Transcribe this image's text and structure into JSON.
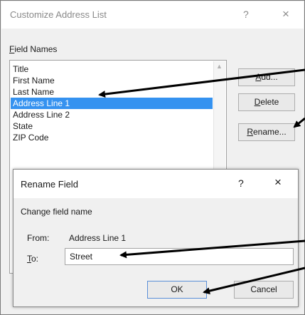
{
  "main_dialog": {
    "title": "Customize Address List",
    "help_glyph": "?",
    "close_glyph": "×",
    "field_names_label_accel": "F",
    "field_names_label_rest": "ield Names",
    "fields": [
      "Title",
      "First Name",
      "Last Name",
      "Address Line 1",
      "Address Line 2",
      "State",
      "ZIP Code"
    ],
    "selected_index": 3,
    "buttons": {
      "add_accel": "A",
      "add_rest": "dd...",
      "delete_pre": "",
      "delete_accel": "D",
      "delete_rest": "elete",
      "rename_accel": "R",
      "rename_rest": "ename..."
    }
  },
  "rename_dialog": {
    "title": "Rename Field",
    "help_glyph": "?",
    "close_glyph": "×",
    "change_label": "Change field name",
    "from_label": "From:",
    "from_value": "Address Line 1",
    "to_label_accel": "T",
    "to_label_rest": "o:",
    "to_value": "Street",
    "ok_label": "OK",
    "cancel_label": "Cancel"
  }
}
